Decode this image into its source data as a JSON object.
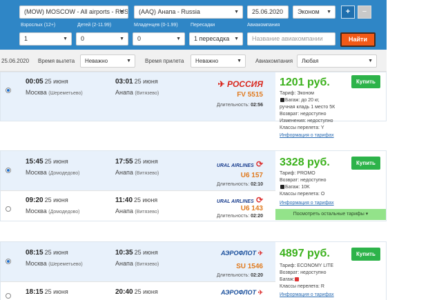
{
  "search": {
    "from": "(MOW) MOSCOW - All airports - RUS",
    "to": "(AAQ) Анапа - Russia",
    "date": "25.06.2020",
    "cabin": "Эконом",
    "labels": {
      "adults": "Взрослых (12+)",
      "children": "Детей (2-11.99)",
      "infants": "Младенцев (0-1.99)",
      "transfers": "Пересадки",
      "airline": "Авиакомпания"
    },
    "adults_value": "1",
    "children_value": "0",
    "infants_value": "0",
    "transfers_value": "1 пересадка",
    "airline_placeholder": "Название авиакомпании",
    "find_label": "Найти",
    "plus": "+",
    "minus": "−"
  },
  "filters": {
    "date": "25.06.2020",
    "departure_label": "Время вылета",
    "departure_value": "Неважно",
    "arrival_label": "Время прилета",
    "arrival_value": "Неважно",
    "airline_label": "Авиакомпания",
    "airline_value": "Любая"
  },
  "results": [
    {
      "flights": [
        {
          "dep_time": "00:05",
          "dep_date": "25 июня",
          "dep_city": "Москва",
          "dep_airport": "(Шереметьево)",
          "arr_time": "03:01",
          "arr_date": "25 июня",
          "arr_city": "Анапа",
          "arr_airport": "(Витязево)",
          "airline": "РОССИЯ",
          "flight_no": "FV 5515",
          "duration_label": "Длительность:",
          "duration": "02:56"
        }
      ],
      "price": "1201 руб.",
      "buy": "Купить",
      "details": [
        "Тариф: Эконом",
        "Багаж: до 20 кг,",
        "ручная кладь 1 место 5К",
        "Возврат: недоступно",
        "Изменения: недоступно",
        "Классы перелета: Y"
      ],
      "link": "Информация о тарифах"
    },
    {
      "flights": [
        {
          "dep_time": "15:45",
          "dep_date": "25 июня",
          "dep_city": "Москва",
          "dep_airport": "(Домодедово)",
          "arr_time": "17:55",
          "arr_date": "25 июня",
          "arr_city": "Анапа",
          "arr_airport": "(Витязево)",
          "airline": "URAL AIRLINES",
          "flight_no": "U6 157",
          "duration_label": "Длительность:",
          "duration": "02:10"
        },
        {
          "dep_time": "09:20",
          "dep_date": "25 июня",
          "dep_city": "Москва",
          "dep_airport": "(Домодедово)",
          "arr_time": "11:40",
          "arr_date": "25 июня",
          "arr_city": "Анапа",
          "arr_airport": "(Витязево)",
          "airline": "URAL AIRLINES",
          "flight_no": "U6 143",
          "duration_label": "Длительность:",
          "duration": "02:20"
        }
      ],
      "price": "3328 руб.",
      "buy": "Купить",
      "details": [
        "Тариф: PROMO",
        "Возврат: недоступно",
        "Багаж: 10K",
        "Классы перелета: O"
      ],
      "link": "Информация о тарифах",
      "more": "Посмотреть остальные тарифы ▾"
    },
    {
      "flights": [
        {
          "dep_time": "08:15",
          "dep_date": "25 июня",
          "dep_city": "Москва",
          "dep_airport": "(Шереметьево)",
          "arr_time": "10:35",
          "arr_date": "25 июня",
          "arr_city": "Анапа",
          "arr_airport": "(Витязево)",
          "airline": "АЭРОФЛОТ",
          "flight_no": "SU 1546",
          "duration_label": "Длительность:",
          "duration": "02:20"
        },
        {
          "dep_time": "18:15",
          "dep_date": "25 июня",
          "arr_time": "20:40",
          "arr_date": "25 июня",
          "airline": "АЭРОФЛОТ"
        }
      ],
      "price": "4897 руб.",
      "buy": "Купить",
      "details": [
        "Тариф: ECONOMY LITE",
        "Возврат: недоступно",
        "Багаж:",
        "Классы перелета: R"
      ],
      "link": "Информация о тарифах"
    }
  ],
  "colors": {
    "header_bg": "#2f86c6",
    "find_button": "#f25a17",
    "buy_button": "#2db34a",
    "price": "#39b01a",
    "flight_no": "#e07a1e",
    "rossiya_logo": "#d9261c",
    "ural_logo": "#1b3f8f",
    "aeroflot_logo": "#1a4f9c"
  }
}
